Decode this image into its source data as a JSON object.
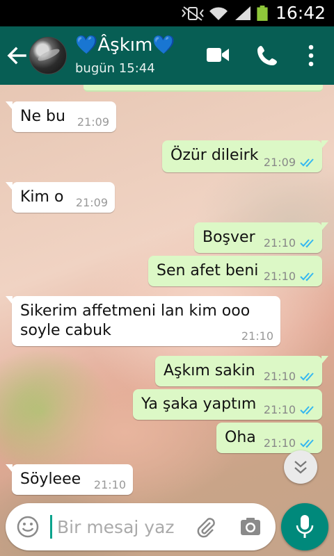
{
  "status_bar": {
    "time": "16:42"
  },
  "header": {
    "contact_name": "💙Âşkım💙",
    "last_seen": "bugün 15:44"
  },
  "messages": [
    {
      "direction": "in",
      "text": "Ne bu",
      "time": "21:09"
    },
    {
      "direction": "out",
      "text": "Özür dileirk",
      "time": "21:09",
      "read": true
    },
    {
      "direction": "in",
      "text": "Kim o",
      "time": "21:09"
    },
    {
      "direction": "out",
      "text": "Boşver",
      "time": "21:10",
      "read": true
    },
    {
      "direction": "out",
      "text": "Sen afet beni",
      "time": "21:10",
      "read": true
    },
    {
      "direction": "in",
      "text_line1": "Sikerim affetmeni lan kim ooo",
      "text_line2": "soyle cabuk",
      "time": "21:10"
    },
    {
      "direction": "out",
      "text": "Aşkım sakin",
      "time": "21:10",
      "read": true
    },
    {
      "direction": "out",
      "text": "Ya şaka yaptım",
      "time": "21:10",
      "read": true
    },
    {
      "direction": "out",
      "text": "Oha",
      "time": "21:10",
      "read": true
    },
    {
      "direction": "in",
      "text": "Söyleee",
      "time": "21:10"
    }
  ],
  "input": {
    "placeholder": "Bir mesaj yaz"
  },
  "colors": {
    "app_bar": "#075e54",
    "outgoing_bubble": "#dcf8c6",
    "incoming_bubble": "#ffffff",
    "read_tick": "#34b7f1",
    "mic_button": "#00897b"
  }
}
